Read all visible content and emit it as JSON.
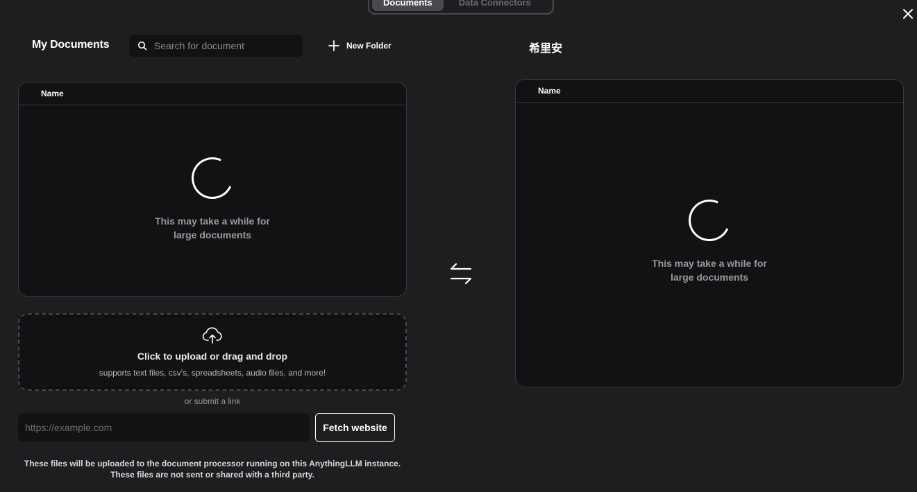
{
  "tabs": {
    "documents": "Documents",
    "data_connectors": "Data Connectors"
  },
  "my_documents": {
    "title": "My Documents",
    "search_placeholder": "Search for document",
    "new_folder_label": "New Folder",
    "column_name": "Name",
    "loading_line1": "This may take a while for",
    "loading_line2": "large documents"
  },
  "upload": {
    "title": "Click to upload or drag and drop",
    "subtitle": "supports text files, csv's, spreadsheets, audio files, and more!",
    "or_link": "or submit a link",
    "url_placeholder": "https://example.com",
    "fetch_label": "Fetch website",
    "disclaimer_line1": "These files will be uploaded to the document processor running on this AnythingLLM instance.",
    "disclaimer_line2": "These files are not sent or shared with a third party."
  },
  "workspace": {
    "title": "希里安",
    "column_name": "Name",
    "loading_line1": "This may take a while for",
    "loading_line2": "large documents"
  },
  "icons": {
    "close": "close-icon",
    "search": "search-icon",
    "plus": "plus-icon",
    "upload": "cloud-upload-icon",
    "swap": "swap-arrows-icon",
    "spinner": "loading-spinner-icon"
  }
}
